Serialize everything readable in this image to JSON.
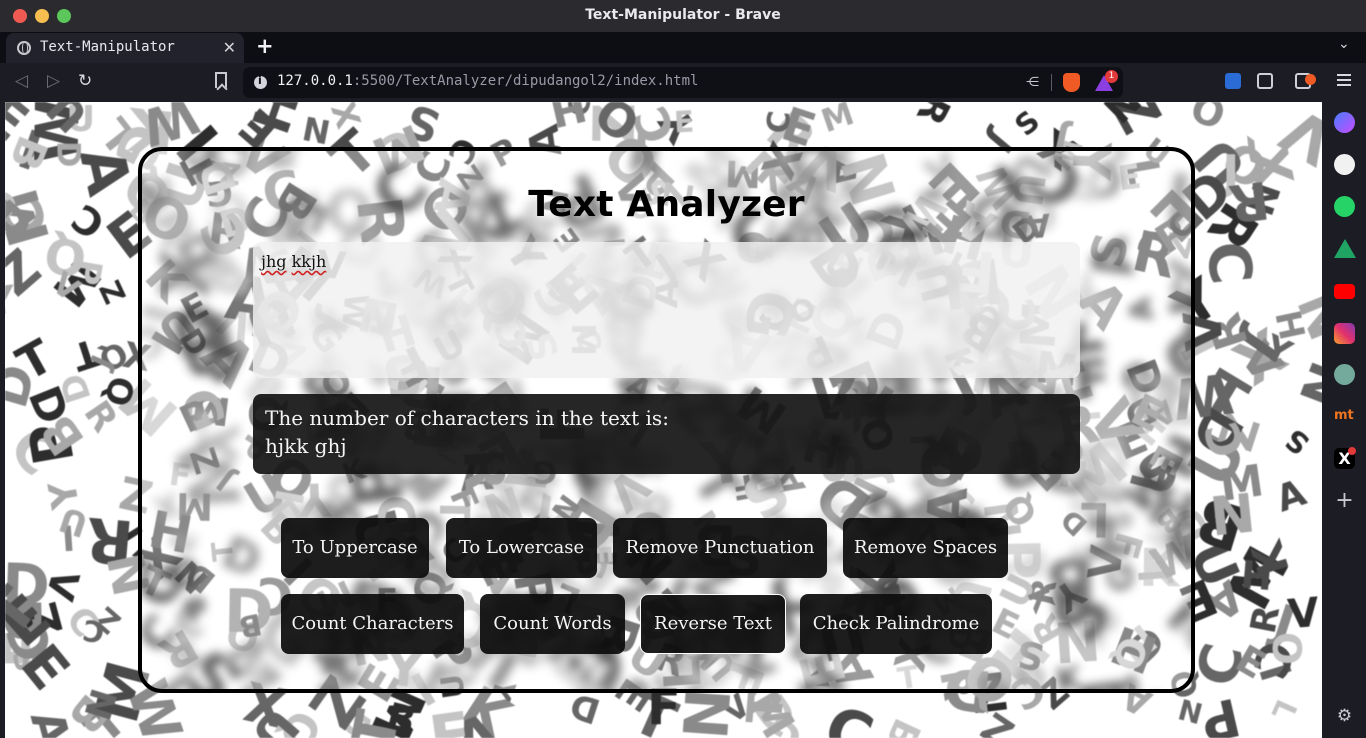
{
  "window": {
    "title": "Text-Manipulator - Brave"
  },
  "tabs": [
    {
      "title": "Text-Manipulator",
      "icon": "globe-icon"
    }
  ],
  "address": {
    "host": "127.0.0.1",
    "rest": ":5500/TextAnalyzer/dipudangol2/index.html"
  },
  "badges": {
    "rewards_count": "1"
  },
  "sidebar": {
    "items": [
      "messenger-icon",
      "github-icon",
      "whatsapp-icon",
      "google-drive-icon",
      "youtube-icon",
      "instagram-icon",
      "chatgpt-icon",
      "mt-icon",
      "x-icon",
      "add-icon",
      "settings-icon"
    ],
    "mt_label": "mt",
    "x_label": "X",
    "add_label": "+",
    "settings_glyph": "⚙"
  },
  "app": {
    "heading": "Text Analyzer",
    "input_words": [
      "jhg",
      "kkjh"
    ],
    "result_line1": "The number of characters in the text is:",
    "result_line2": "hjkk ghj",
    "buttons": {
      "uppercase": "To Uppercase",
      "lowercase": "To Lowercase",
      "remove_punctuation": "Remove Punctuation",
      "remove_spaces": "Remove Spaces",
      "count_characters": "Count Characters",
      "count_words": "Count Words",
      "reverse_text": "Reverse Text",
      "check_palindrome": "Check Palindrome"
    }
  }
}
